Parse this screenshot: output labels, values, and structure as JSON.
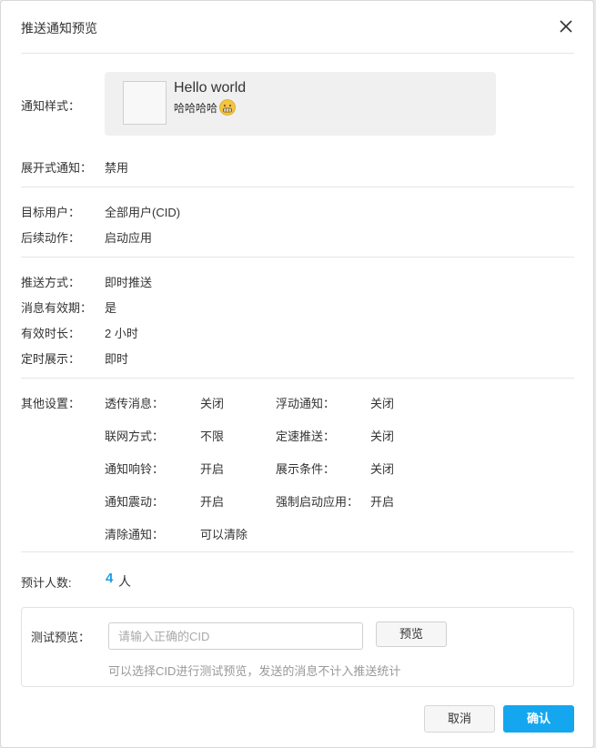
{
  "dialog": {
    "title": "推送通知预览"
  },
  "notification_style": {
    "label": "通知样式：",
    "title": "Hello world",
    "body": "哈哈哈哈"
  },
  "expand": {
    "label": "展开式通知：",
    "value": "禁用"
  },
  "target": {
    "label": "目标用户：",
    "value": "全部用户(CID)",
    "action_label": "后续动作：",
    "action_value": "启动应用"
  },
  "push": {
    "method_label": "推送方式：",
    "method_value": "即时推送",
    "validity_label": "消息有效期：",
    "validity_value": "是",
    "duration_label": "有效时长：",
    "duration_value": "2 小时",
    "schedule_label": "定时展示：",
    "schedule_value": "即时"
  },
  "other": {
    "label": "其他设置：",
    "left": [
      {
        "label": "透传消息：",
        "value": "关闭"
      },
      {
        "label": "联网方式：",
        "value": "不限"
      },
      {
        "label": "通知响铃：",
        "value": "开启"
      },
      {
        "label": "通知震动：",
        "value": "开启"
      },
      {
        "label": "清除通知：",
        "value": "可以清除"
      }
    ],
    "right": [
      {
        "label": "浮动通知：",
        "value": "关闭"
      },
      {
        "label": "定速推送：",
        "value": "关闭"
      },
      {
        "label": "展示条件：",
        "value": "关闭"
      },
      {
        "label": "强制启动应用：",
        "value": "开启"
      }
    ]
  },
  "estimate": {
    "label": "预计人数:",
    "count": "4",
    "unit": "人"
  },
  "test": {
    "label": "测试预览：",
    "placeholder": "请输入正确的CID",
    "value": "",
    "button": "预览",
    "hint": "可以选择CID进行测试预览，发送的消息不计入推送统计"
  },
  "footer": {
    "cancel": "取消",
    "confirm": "确认"
  },
  "colors": {
    "accent": "#14a7f0",
    "count": "#1aa0e6"
  },
  "icons": {
    "close": "close-icon",
    "emoji": "grimace-emoji-icon",
    "app": "app-icon-placeholder"
  }
}
